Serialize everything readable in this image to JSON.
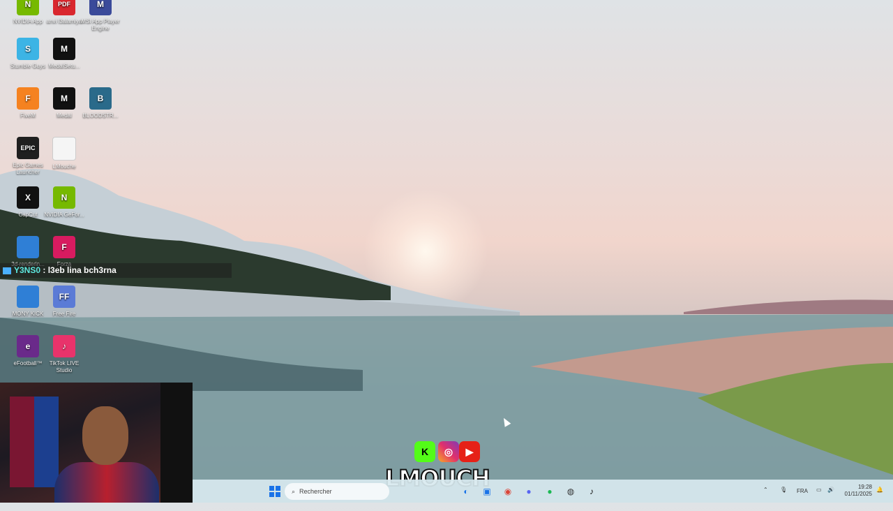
{
  "desktop_icons": [
    {
      "label": "NVIDIA App",
      "bg": "#76b900",
      "glyph": "N"
    },
    {
      "label": "anvi l3alamiya",
      "bg": "#d9272e",
      "glyph": "PDF"
    },
    {
      "label": "MSI App Player Engine",
      "bg": "#3a4a9a",
      "glyph": "M"
    },
    {
      "label": "Stumble Guys",
      "bg": "#3cb4e5",
      "glyph": "S"
    },
    {
      "label": "MedalSetu...",
      "bg": "#111111",
      "glyph": "M"
    },
    {
      "label": "FiveM",
      "bg": "#f58220",
      "glyph": "F"
    },
    {
      "label": "Medal",
      "bg": "#111111",
      "glyph": "M"
    },
    {
      "label": "BLOODSTR...",
      "bg": "#2a6a8a",
      "glyph": "B"
    },
    {
      "label": "Epic Games Launcher",
      "bg": "#1f1f1f",
      "glyph": "EPIC"
    },
    {
      "label": "LMouche",
      "bg": "#f5f5f5",
      "glyph": ""
    },
    {
      "label": "CapCut",
      "bg": "#111111",
      "glyph": "X"
    },
    {
      "label": "NVIDIA GeFor...",
      "bg": "#76b900",
      "glyph": "N"
    },
    {
      "label": "3d-renderin...",
      "bg": "#2f7fd6",
      "glyph": ""
    },
    {
      "label": "Forza",
      "bg": "#d81b60",
      "glyph": "F"
    },
    {
      "label": "MONY KICK",
      "bg": "#2f7fd6",
      "glyph": ""
    },
    {
      "label": "Free Fire",
      "bg": "#5b7bd6",
      "glyph": "FF"
    },
    {
      "label": "eFootball™",
      "bg": "#6a2a8a",
      "glyph": "e"
    },
    {
      "label": "TikTok LIVE Studio",
      "bg": "#e8336b",
      "glyph": "♪"
    }
  ],
  "chat": {
    "user": "Y3NS0",
    "separator": " : ",
    "message": "l3eb lina bch3rna"
  },
  "taskbar": {
    "search_placeholder": "Rechercher",
    "language": "FRA",
    "time": "19:28",
    "date": "01/11/2025"
  },
  "overlay": {
    "logo_text": "LMOUCH"
  },
  "colors": {
    "taskbar_bg": "#d8e9ef",
    "chat_user": "#5ee9e0"
  }
}
